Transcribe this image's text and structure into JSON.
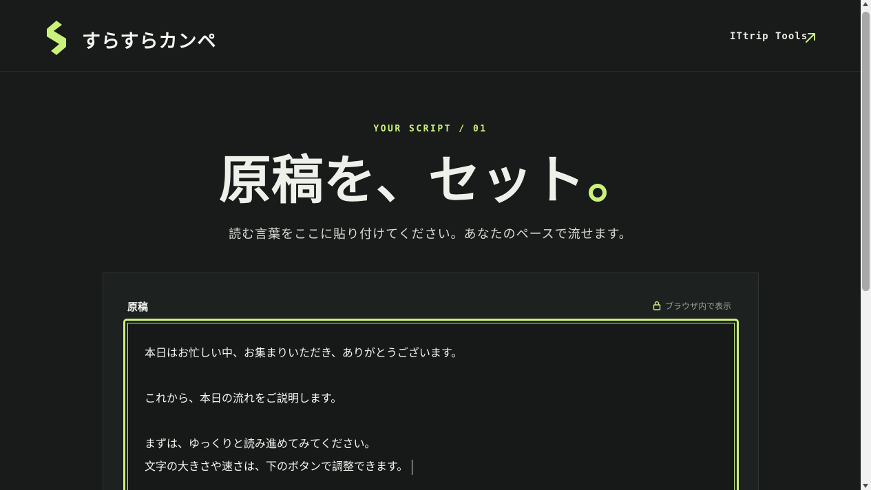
{
  "header": {
    "logo_text": "すらすらカンペ",
    "nav_link": "ITtrip Tools",
    "accent": "#c9f27a"
  },
  "hero": {
    "eyebrow": "YOUR SCRIPT / 01",
    "title": "原稿を、セット",
    "subtitle": "読む言葉をここに貼り付けてください。あなたのペースで流せます。"
  },
  "editor": {
    "label": "原稿",
    "privacy_note": "ブラウザ内で表示",
    "lines": [
      "本日はお忙しい中、お集まりいただき、ありがとうございます。",
      "",
      "これから、本日の流れをご説明します。",
      "",
      "まずは、ゆっくりと読み進めてみてください。",
      "文字の大きさや速さは、下のボタンで調整できます。"
    ]
  },
  "icons": {
    "logo": "logo-s-icon",
    "nav_arrow": "arrow-up-right-icon",
    "privacy": "lock-icon"
  }
}
